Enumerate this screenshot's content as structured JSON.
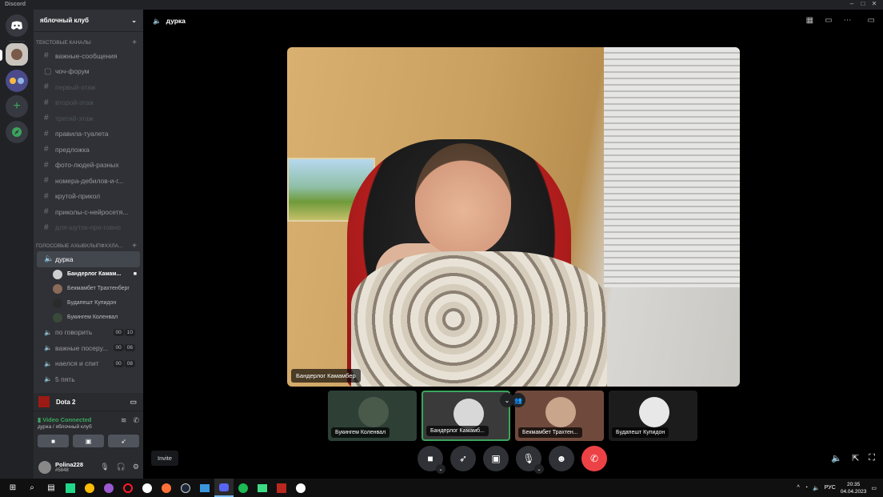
{
  "window": {
    "app_name": "Discord"
  },
  "server": {
    "name": "яблочный клуб"
  },
  "categories": {
    "text": "ТЕКСТОВЫЕ КАНАЛЫ",
    "voice": "ГОЛОСОВЫЕ АХЫВХЛЫПФХХЛА..."
  },
  "text_channels": [
    {
      "name": "важные-сообщения",
      "icon": "hash-icon",
      "muted": false
    },
    {
      "name": "чоч-форум",
      "icon": "forum-icon",
      "muted": false
    },
    {
      "name": "первый-этаж",
      "icon": "hash-icon",
      "muted": true
    },
    {
      "name": "второй-этаж",
      "icon": "hash-icon",
      "muted": true
    },
    {
      "name": "третий-этаж",
      "icon": "hash-icon",
      "muted": true
    },
    {
      "name": "правила-туалета",
      "icon": "hash-icon",
      "muted": false
    },
    {
      "name": "предложка",
      "icon": "hash-icon",
      "muted": false
    },
    {
      "name": "фото-людей-разных",
      "icon": "hash-icon",
      "muted": false
    },
    {
      "name": "номера-дебилов-и-г...",
      "icon": "hash-icon",
      "muted": false
    },
    {
      "name": "крутой-прикол",
      "icon": "hash-icon",
      "muted": false
    },
    {
      "name": "приколы-с-нейросетя...",
      "icon": "hash-icon",
      "muted": false
    },
    {
      "name": "для-шуток-про-говно",
      "icon": "hash-icon",
      "muted": true
    }
  ],
  "voice_channels": {
    "active": {
      "name": "дурка"
    },
    "members": [
      {
        "name": "Бандерлог Камам...",
        "streaming": true
      },
      {
        "name": "Бекмамбет Трахтенберг",
        "streaming": false
      },
      {
        "name": "Будапешт Купидон",
        "streaming": false
      },
      {
        "name": "Букингем Коленвал",
        "streaming": false
      }
    ],
    "others": [
      {
        "name": "по говорить",
        "a": "00",
        "b": "10"
      },
      {
        "name": "важные посеру...",
        "a": "00",
        "b": "06"
      },
      {
        "name": "наелся и спит",
        "a": "00",
        "b": "08"
      },
      {
        "name": "5 пять",
        "a": "",
        "b": ""
      }
    ]
  },
  "game_activity": {
    "name": "Dota 2"
  },
  "voice_panel": {
    "status": "Video Connected",
    "location": "дурка / яблочный клуб"
  },
  "user": {
    "name": "Polina228",
    "tag": "#5848"
  },
  "tooltip": {
    "text": "Invite"
  },
  "header": {
    "channel": "дурка"
  },
  "stage": {
    "label": "Бандерлог Камамбер"
  },
  "tiles": [
    {
      "label": "Букингем Коленвал",
      "selected": false,
      "color": "#2e4036"
    },
    {
      "label": "Бандерлог Камамб...",
      "selected": true,
      "color": "#3a3a3a"
    },
    {
      "label": "Бекмамбет Трахтен...",
      "selected": false,
      "color": "#6f4a3c"
    },
    {
      "label": "Будапешт Купидон",
      "selected": false,
      "color": "#1c1c1c"
    }
  ],
  "taskbar": {
    "lang": "РУС",
    "time": "20:35",
    "date": "04.04.2023"
  },
  "colors": {
    "accent_green": "#3ba55d",
    "danger": "#ed4245",
    "sidebar": "#2f3136"
  }
}
